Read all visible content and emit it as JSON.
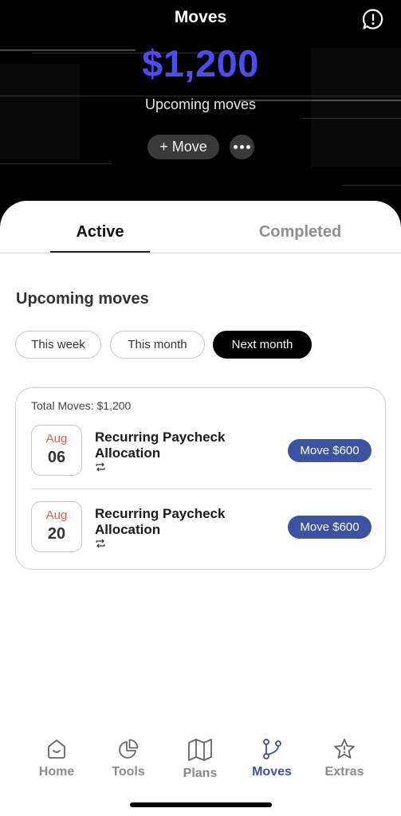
{
  "header": {
    "title": "Moves",
    "amount": "$1,200",
    "subtitle": "Upcoming moves",
    "add_move_label": "+ Move"
  },
  "tabs": [
    {
      "label": "Active",
      "active": true
    },
    {
      "label": "Completed",
      "active": false
    }
  ],
  "section": {
    "title": "Upcoming moves",
    "filters": [
      {
        "label": "This week",
        "selected": false
      },
      {
        "label": "This month",
        "selected": false
      },
      {
        "label": "Next month",
        "selected": true
      }
    ]
  },
  "card": {
    "total": "Total Moves: $1,200",
    "moves": [
      {
        "month": "Aug",
        "day": "06",
        "title": "Recurring Paycheck Allocation",
        "action": "Move $600",
        "icon": "repeat-icon"
      },
      {
        "month": "Aug",
        "day": "20",
        "title": "Recurring Paycheck Allocation",
        "action": "Move $600",
        "icon": "repeat-icon"
      }
    ]
  },
  "nav": [
    {
      "label": "Home",
      "icon": "home-icon",
      "active": false
    },
    {
      "label": "Tools",
      "icon": "pie-chart-icon",
      "active": false
    },
    {
      "label": "Plans",
      "icon": "map-icon",
      "active": false
    },
    {
      "label": "Moves",
      "icon": "branch-icon",
      "active": true
    },
    {
      "label": "Extras",
      "icon": "star-icon",
      "active": false
    }
  ],
  "colors": {
    "accent_amount": "#4f4cf0",
    "accent_nav": "#3d52a0",
    "date_month": "#e8584f"
  }
}
